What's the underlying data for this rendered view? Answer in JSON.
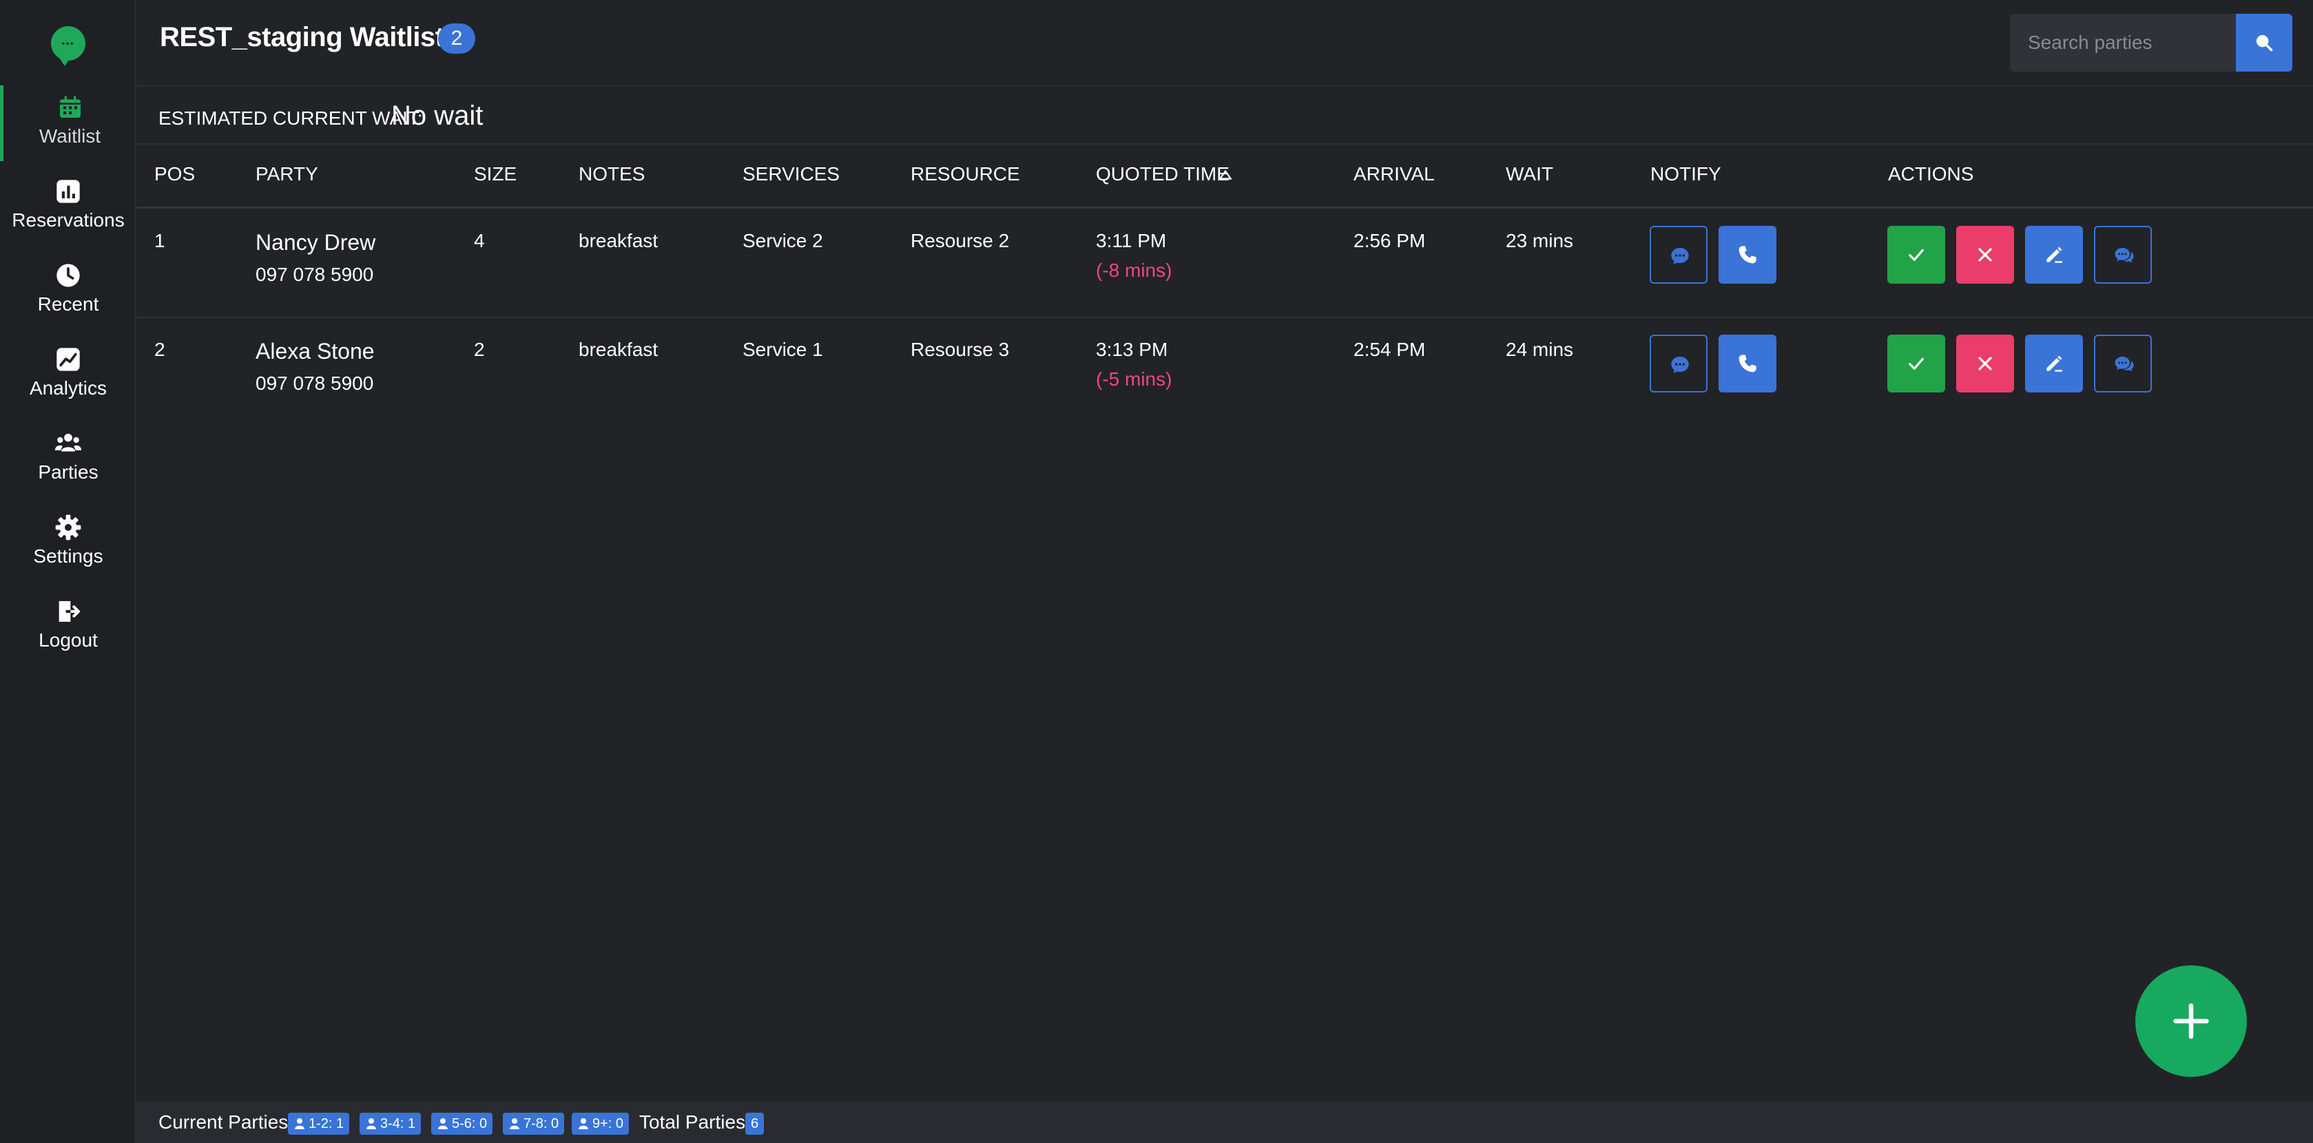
{
  "sidebar": {
    "items": [
      {
        "label": "Waitlist",
        "icon": "calendar-icon"
      },
      {
        "label": "Reservations",
        "icon": "bar-chart-icon"
      },
      {
        "label": "Recent",
        "icon": "clock-icon"
      },
      {
        "label": "Analytics",
        "icon": "line-chart-icon"
      },
      {
        "label": "Parties",
        "icon": "users-icon"
      },
      {
        "label": "Settings",
        "icon": "gear-icon"
      },
      {
        "label": "Logout",
        "icon": "logout-icon"
      }
    ]
  },
  "header": {
    "title": "REST_staging Waitlist",
    "badge": "2",
    "search_placeholder": "Search parties"
  },
  "estimate": {
    "label": "ESTIMATED CURRENT WAIT:",
    "value": "No wait"
  },
  "table": {
    "columns": [
      "POS",
      "PARTY",
      "SIZE",
      "NOTES",
      "SERVICES",
      "RESOURCE",
      "QUOTED TIME",
      "ARRIVAL",
      "WAIT",
      "NOTIFY",
      "ACTIONS"
    ],
    "rows": [
      {
        "pos": "1",
        "name": "Nancy Drew",
        "phone": "097 078 5900",
        "size": "4",
        "notes": "breakfast",
        "service": "Service 2",
        "resource": "Resourse 2",
        "quoted": "3:11 PM",
        "delta": "(-8 mins)",
        "arrival": "2:56 PM",
        "wait": "23 mins"
      },
      {
        "pos": "2",
        "name": "Alexa Stone",
        "phone": "097 078 5900",
        "size": "2",
        "notes": "breakfast",
        "service": "Service 1",
        "resource": "Resourse 3",
        "quoted": "3:13 PM",
        "delta": "(-5 mins)",
        "arrival": "2:54 PM",
        "wait": "24 mins"
      }
    ]
  },
  "footer": {
    "current_label": "Current Parties:",
    "chips": [
      "1-2: 1",
      "3-4: 1",
      "5-6: 0",
      "7-8: 0",
      "9+: 0"
    ],
    "total_label": "Total Parties:",
    "total": "6"
  },
  "colors": {
    "accent_green": "#1fa85a",
    "accent_blue": "#3a74d6",
    "danger": "#ea3d6b",
    "background": "#222327"
  }
}
